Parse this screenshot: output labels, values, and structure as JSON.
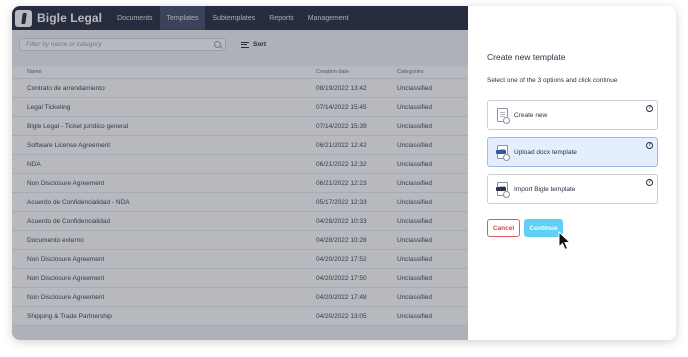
{
  "app": {
    "brand": "Bigle Legal",
    "nav": [
      {
        "label": "Documents",
        "active": false
      },
      {
        "label": "Templates",
        "active": true
      },
      {
        "label": "Subtemplates",
        "active": false
      },
      {
        "label": "Reports",
        "active": false
      },
      {
        "label": "Management",
        "active": false
      }
    ]
  },
  "list": {
    "search_placeholder": "Filter by name or category",
    "sort_label": "Sort",
    "columns": {
      "name": "Name",
      "date": "Creation date",
      "category": "Categories"
    },
    "rows": [
      {
        "name": "Contrato de arrendamiento",
        "date": "08/19/2022 13:42",
        "category": "Unclassified"
      },
      {
        "name": "Legal Ticketing",
        "date": "07/14/2022 15:45",
        "category": "Unclassified"
      },
      {
        "name": "Bigle Legal - Ticket jurídico general",
        "date": "07/14/2022 15:39",
        "category": "Unclassified"
      },
      {
        "name": "Software License Agreement",
        "date": "06/21/2022 12:42",
        "category": "Unclassified"
      },
      {
        "name": "NDA",
        "date": "06/21/2022 12:32",
        "category": "Unclassified"
      },
      {
        "name": "Non Disclosure Agreement",
        "date": "06/21/2022 12:23",
        "category": "Unclassified"
      },
      {
        "name": "Acuerdo de Confidencialidad - NDA",
        "date": "05/17/2022 12:33",
        "category": "Unclassified"
      },
      {
        "name": "Acuerdo de Confidencialidad",
        "date": "04/28/2022 10:33",
        "category": "Unclassified"
      },
      {
        "name": "Documento externo",
        "date": "04/28/2022 10:28",
        "category": "Unclassified"
      },
      {
        "name": "Non Disclosure Agreement",
        "date": "04/20/2022 17:52",
        "category": "Unclassified"
      },
      {
        "name": "Non Disclosure Agreement",
        "date": "04/20/2022 17:50",
        "category": "Unclassified"
      },
      {
        "name": "Non Disclosure Agreement",
        "date": "04/20/2022 17:48",
        "category": "Unclassified"
      },
      {
        "name": "Shipping & Trade Partnership",
        "date": "04/20/2022 13:05",
        "category": "Unclassified"
      }
    ]
  },
  "panel": {
    "title": "Create new template",
    "subtitle": "Select one of the 3 options and click continue",
    "options": [
      {
        "label": "Create new",
        "icon": "document-icon",
        "selected": false
      },
      {
        "label": "Upload docx template",
        "icon": "docx-file-icon",
        "selected": true
      },
      {
        "label": "Import Bigle template",
        "icon": "bigle-file-icon",
        "selected": false
      }
    ],
    "help_glyph": "?",
    "cancel_label": "Cancel",
    "continue_label": "Continue"
  },
  "colors": {
    "nav_bg": "#2b3245",
    "accent": "#5fd0f3",
    "cancel": "#d94848",
    "selected_option_bg": "#e4eefc"
  }
}
